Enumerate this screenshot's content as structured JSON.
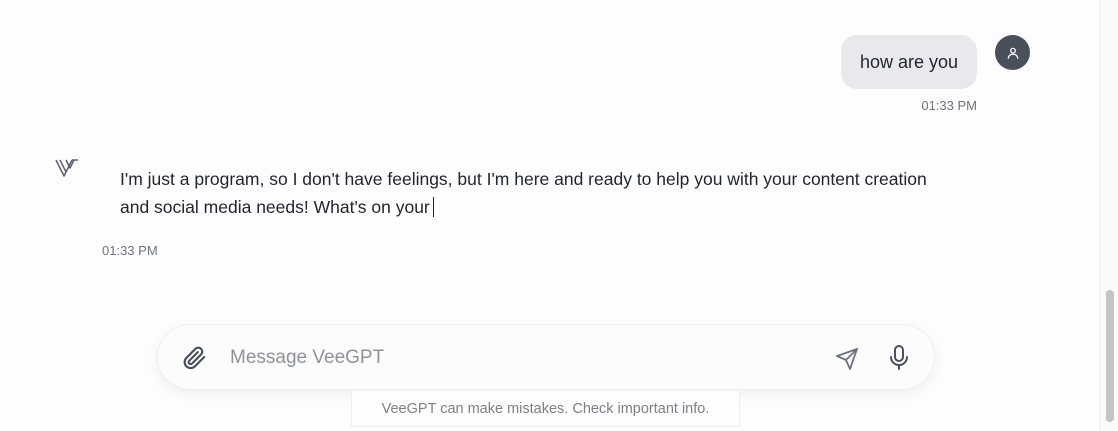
{
  "conversation": {
    "user_message": {
      "text": "how are you",
      "time": "01:33 PM",
      "avatar_icon": "user-icon"
    },
    "assistant_message": {
      "text": "I'm just a program, so I don't have feelings, but I'm here and ready to help you with your content creation and social media needs! What's on your",
      "time": "01:33 PM",
      "logo_icon": "veegpt-logo-icon"
    }
  },
  "composer": {
    "placeholder": "Message VeeGPT",
    "value": "",
    "attach_icon": "paperclip-icon",
    "send_icon": "send-icon",
    "mic_icon": "microphone-icon"
  },
  "disclaimer": "VeeGPT can make mistakes. Check important info.",
  "colors": {
    "user_bubble": "#e8e9ec",
    "avatar": "#4a505b",
    "text": "#1f2430",
    "muted": "#6b7280"
  }
}
